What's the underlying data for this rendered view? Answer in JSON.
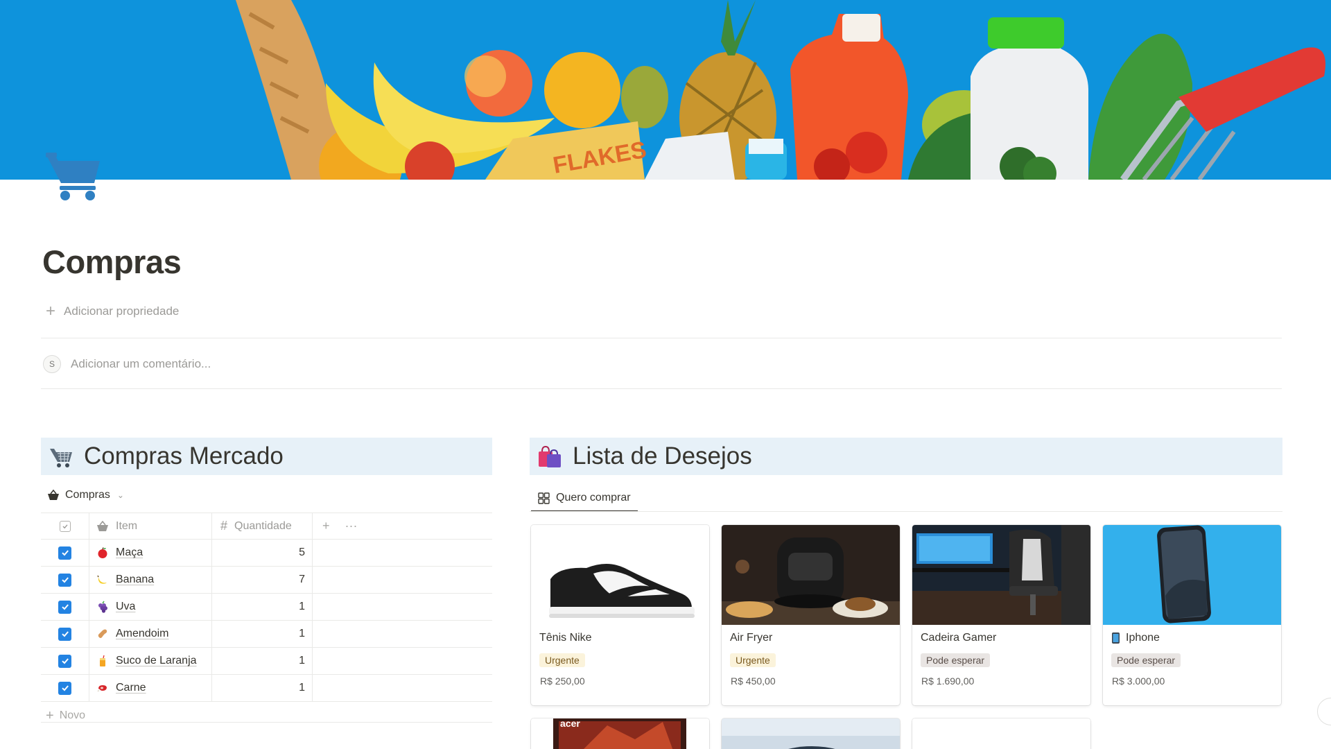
{
  "page": {
    "title": "Compras",
    "add_property": "Adicionar propriedade",
    "comment_placeholder": "Adicionar um comentário...",
    "avatar_letter": "S"
  },
  "cover": {
    "description_icon": "grocery-cover-image",
    "background_color": "#0b8fd9"
  },
  "page_icon": "shopping-cart-icon",
  "left_section": {
    "heading": "Compras Mercado",
    "icon": "shopping-cart-emoji",
    "view_name": "Compras",
    "view_icon": "basket-icon",
    "columns": {
      "item": "Item",
      "quantity": "Quantidade"
    },
    "rows": [
      {
        "name": "Maça",
        "qty": "5",
        "icon": "apple-emoji",
        "checked": true
      },
      {
        "name": "Banana",
        "qty": "7",
        "icon": "banana-emoji",
        "checked": true
      },
      {
        "name": "Uva",
        "qty": "1",
        "icon": "grapes-emoji",
        "checked": true
      },
      {
        "name": "Amendoim",
        "qty": "1",
        "icon": "peanut-emoji",
        "checked": true
      },
      {
        "name": "Suco de Laranja",
        "qty": "1",
        "icon": "juice-emoji",
        "checked": true
      },
      {
        "name": "Carne",
        "qty": "1",
        "icon": "meat-emoji",
        "checked": true
      }
    ],
    "new_label": "Novo"
  },
  "right_section": {
    "heading": "Lista de Desejos",
    "icon": "shopping-bags-emoji",
    "view_name": "Quero comprar",
    "view_icon": "gallery-grid-icon",
    "cards": [
      {
        "name": "Tênis Nike",
        "tag": "Urgente",
        "price": "R$ 250,00",
        "image": "sneaker-image"
      },
      {
        "name": "Air Fryer",
        "tag": "Urgente",
        "price": "R$ 450,00",
        "image": "air-fryer-image"
      },
      {
        "name": "Cadeira Gamer",
        "tag": "Pode esperar",
        "price": "R$ 1.690,00",
        "image": "gaming-chair-image"
      },
      {
        "name": "Iphone",
        "tag": "Pode esperar",
        "price": "R$ 3.000,00",
        "image": "iphone-image",
        "icon": "mobile-phone-emoji"
      }
    ],
    "partial_cards": [
      "acer-laptop-image",
      "car-image",
      "empty-image"
    ],
    "partial_brand_text": "acer"
  },
  "colors": {
    "accent": "#2383e2",
    "urgent_bg": "#fbf3db",
    "wait_bg": "#e9e5e3",
    "header_bg": "#e7f1f8"
  }
}
